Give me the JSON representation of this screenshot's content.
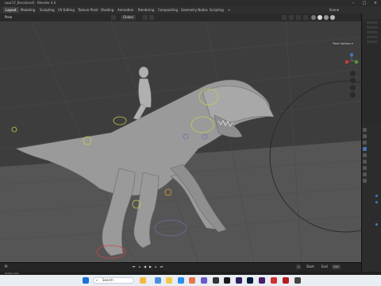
{
  "window": {
    "title": "saur17_Recolored] - Blender 4.0"
  },
  "menubar": {
    "tabs": [
      "Layout",
      "Modeling",
      "Sculpting",
      "UV Editing",
      "Texture Paint",
      "Shading",
      "Animation",
      "Rendering",
      "Compositing",
      "Geometry Nodes",
      "Scripting",
      "+"
    ],
    "scene_label": "Scene"
  },
  "header": {
    "mode": "Pose",
    "orientation": "Global"
  },
  "viewport": {
    "pose_options": "Pose Options ▾"
  },
  "timeline": {
    "label_left": "Pl",
    "frame_start": "1",
    "start_label": "Start",
    "end_label": "End",
    "frame_end": "250"
  },
  "statusbar": {
    "label": "Rotate View"
  },
  "taskbar": {
    "search_placeholder": "Search"
  },
  "colors": {
    "accent": "#4772b3",
    "active_tab": "#444444",
    "viewport_bg": "#3d3d3d"
  }
}
